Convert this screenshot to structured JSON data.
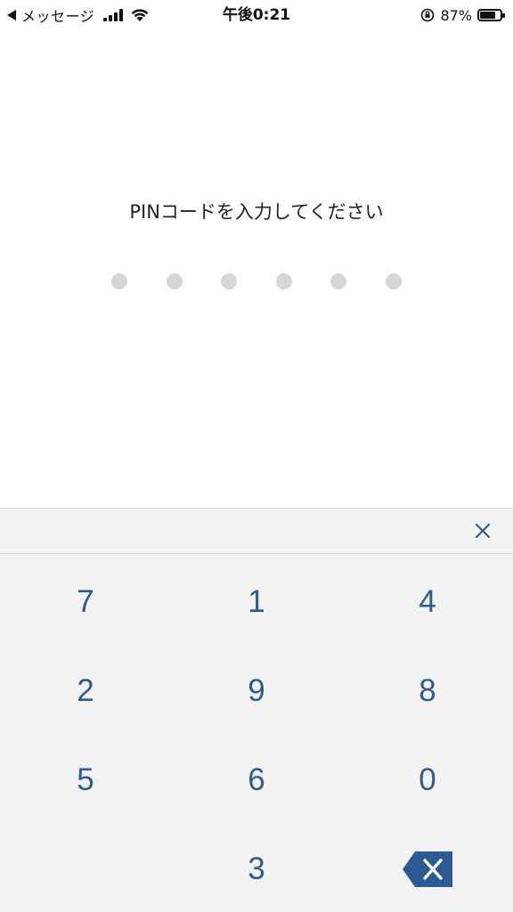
{
  "status_bar": {
    "back_label": "メッセージ",
    "time": "午後0:21",
    "battery_percent": "87%",
    "battery_level": 0.87,
    "icons": [
      "back-arrow-icon",
      "signal-icon",
      "wifi-icon",
      "orientation-lock-icon",
      "battery-icon"
    ]
  },
  "prompt": {
    "text": "PINコードを入力してください"
  },
  "pin": {
    "length": 6,
    "entered": 0
  },
  "keypad": {
    "close_icon": "close-icon",
    "keys": [
      {
        "label": "7"
      },
      {
        "label": "1"
      },
      {
        "label": "4"
      },
      {
        "label": "2"
      },
      {
        "label": "9"
      },
      {
        "label": "8"
      },
      {
        "label": "5"
      },
      {
        "label": "6"
      },
      {
        "label": "0"
      },
      {
        "label": ""
      },
      {
        "label": "3"
      },
      {
        "label": "",
        "icon": "backspace-icon"
      }
    ]
  },
  "colors": {
    "accent": "#2c5b93",
    "keypad_bg": "#f2f2f3",
    "dot_empty": "#d6d6d6"
  }
}
